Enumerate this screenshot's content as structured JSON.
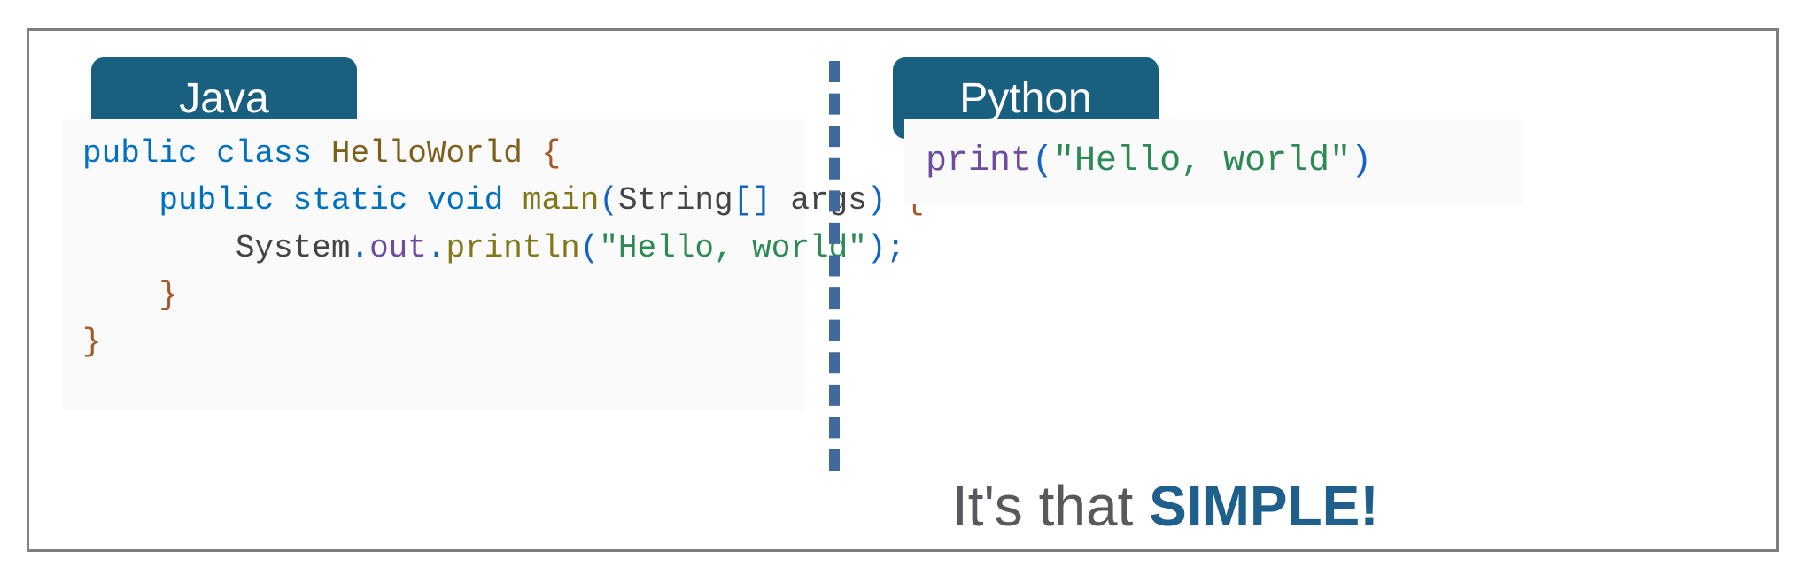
{
  "java": {
    "label": "Java",
    "code": {
      "l1_kw1": "public",
      "l1_kw2": "class",
      "l1_cls": "HelloWorld",
      "l1_ob": "{",
      "l2_kw1": "public",
      "l2_kw2": "static",
      "l2_kw3": "void",
      "l2_mtd": "main",
      "l2_op": "(",
      "l2_type": "String",
      "l2_arr": "[]",
      "l2_arg": "args",
      "l2_cp": ")",
      "l2_ob": "{",
      "l3_sys": "System",
      "l3_dot1": ".",
      "l3_out": "out",
      "l3_dot2": ".",
      "l3_pl": "println",
      "l3_op": "(",
      "l3_str": "\"Hello, world\"",
      "l3_cp": ")",
      "l3_sc": ";",
      "l4_cb": "}",
      "l5_cb": "}"
    }
  },
  "python": {
    "label": "Python",
    "code": {
      "fn": "print",
      "op": "(",
      "str": "\"Hello, world\"",
      "cp": ")"
    }
  },
  "tagline": {
    "pre": "It's that ",
    "emph": "SIMPLE",
    "excl": "!"
  }
}
